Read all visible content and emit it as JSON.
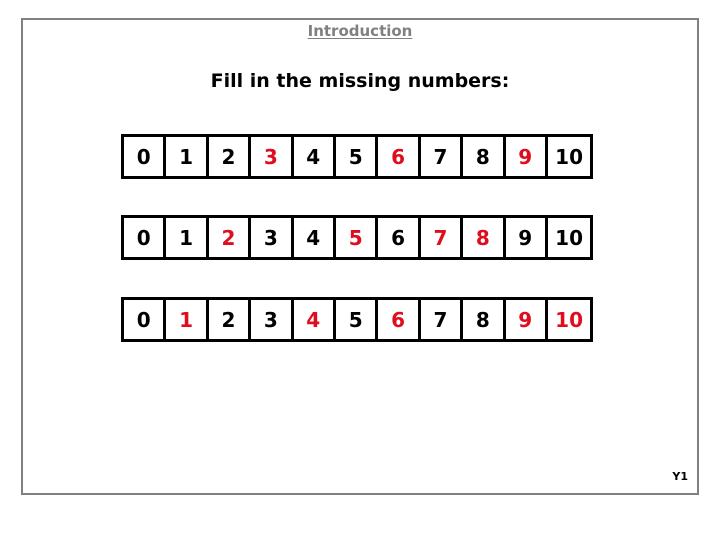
{
  "slide": {
    "title": "Introduction",
    "subtitle": "Fill in the missing numbers:",
    "page_code": "Y1",
    "colors": {
      "frame_border": "#808080",
      "title_text": "#808080",
      "body_text": "#000000",
      "missing_number": "#E00D1E",
      "cell_border": "#000000",
      "background": "#ffffff"
    }
  },
  "strips": [
    {
      "id": "strip-0",
      "cells": [
        {
          "value": "0",
          "missing": false
        },
        {
          "value": "1",
          "missing": false
        },
        {
          "value": "2",
          "missing": false
        },
        {
          "value": "3",
          "missing": true
        },
        {
          "value": "4",
          "missing": false
        },
        {
          "value": "5",
          "missing": false
        },
        {
          "value": "6",
          "missing": true
        },
        {
          "value": "7",
          "missing": false
        },
        {
          "value": "8",
          "missing": false
        },
        {
          "value": "9",
          "missing": true
        },
        {
          "value": "10",
          "missing": false
        }
      ]
    },
    {
      "id": "strip-1",
      "cells": [
        {
          "value": "0",
          "missing": false
        },
        {
          "value": "1",
          "missing": false
        },
        {
          "value": "2",
          "missing": true
        },
        {
          "value": "3",
          "missing": false
        },
        {
          "value": "4",
          "missing": false
        },
        {
          "value": "5",
          "missing": true
        },
        {
          "value": "6",
          "missing": false
        },
        {
          "value": "7",
          "missing": true
        },
        {
          "value": "8",
          "missing": true
        },
        {
          "value": "9",
          "missing": false
        },
        {
          "value": "10",
          "missing": false
        }
      ]
    },
    {
      "id": "strip-2",
      "cells": [
        {
          "value": "0",
          "missing": false
        },
        {
          "value": "1",
          "missing": true
        },
        {
          "value": "2",
          "missing": false
        },
        {
          "value": "3",
          "missing": false
        },
        {
          "value": "4",
          "missing": true
        },
        {
          "value": "5",
          "missing": false
        },
        {
          "value": "6",
          "missing": true
        },
        {
          "value": "7",
          "missing": false
        },
        {
          "value": "8",
          "missing": false
        },
        {
          "value": "9",
          "missing": true
        },
        {
          "value": "10",
          "missing": true
        }
      ]
    }
  ]
}
